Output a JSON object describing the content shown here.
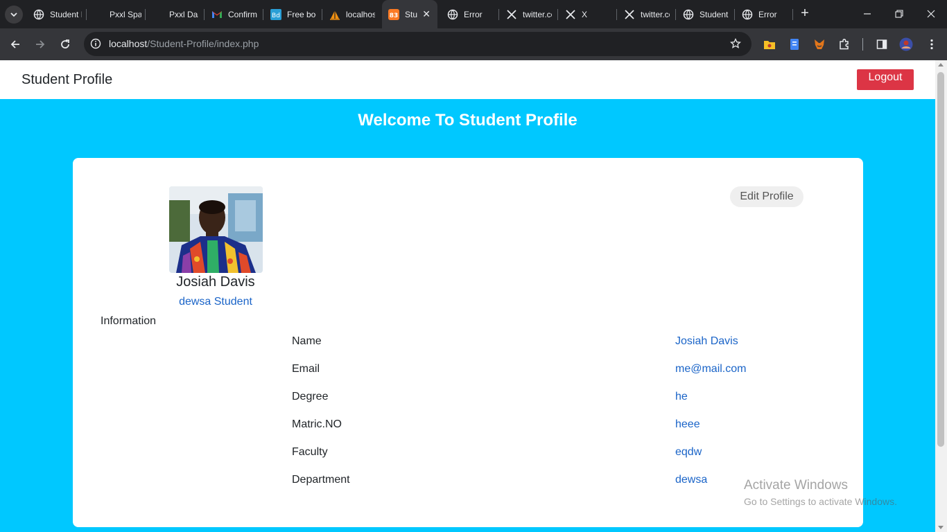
{
  "browser": {
    "tabs": [
      {
        "title": "Student Profile",
        "icon": "globe-icon"
      },
      {
        "title": "Pxxl Space",
        "icon": "pxxl-icon"
      },
      {
        "title": "Pxxl Dashboard",
        "icon": "pxxl-icon"
      },
      {
        "title": "Confirm",
        "icon": "gmail-icon"
      },
      {
        "title": "Free bootstrap",
        "icon": "bd-icon"
      },
      {
        "title": "localhost",
        "icon": "xampp-sail-icon"
      },
      {
        "title": "Student Profile",
        "icon": "xampp-icon",
        "active": true
      },
      {
        "title": "Error",
        "icon": "globe-icon"
      },
      {
        "title": "twitter.com",
        "icon": "x-icon"
      },
      {
        "title": "X",
        "icon": "x-icon"
      },
      {
        "title": "twitter.com",
        "icon": "x-icon"
      },
      {
        "title": "Student Profile",
        "icon": "globe-icon"
      },
      {
        "title": "Error",
        "icon": "globe-icon"
      }
    ],
    "url_host": "localhost",
    "url_path": "/Student-Profile/index.php"
  },
  "navbar": {
    "brand": "Student Profile",
    "logout_label": "Logout"
  },
  "header": {
    "welcome": "Welcome To Student Profile"
  },
  "profile": {
    "name": "Josiah Davis",
    "role": "dewsa Student",
    "edit_label": "Edit Profile",
    "info_heading": "Information",
    "fields": [
      {
        "label": "Name",
        "value": "Josiah Davis"
      },
      {
        "label": "Email",
        "value": "me@mail.com"
      },
      {
        "label": "Degree",
        "value": "he"
      },
      {
        "label": "Matric.NO",
        "value": "heee"
      },
      {
        "label": "Faculty",
        "value": "eqdw"
      },
      {
        "label": "Department",
        "value": "dewsa"
      }
    ]
  },
  "watermark": {
    "line1": "Activate Windows",
    "line2": "Go to Settings to activate Windows."
  },
  "colors": {
    "page_bg": "#00c8ff",
    "logout_bg": "#dc3545",
    "link_blue": "#1a64c8"
  }
}
